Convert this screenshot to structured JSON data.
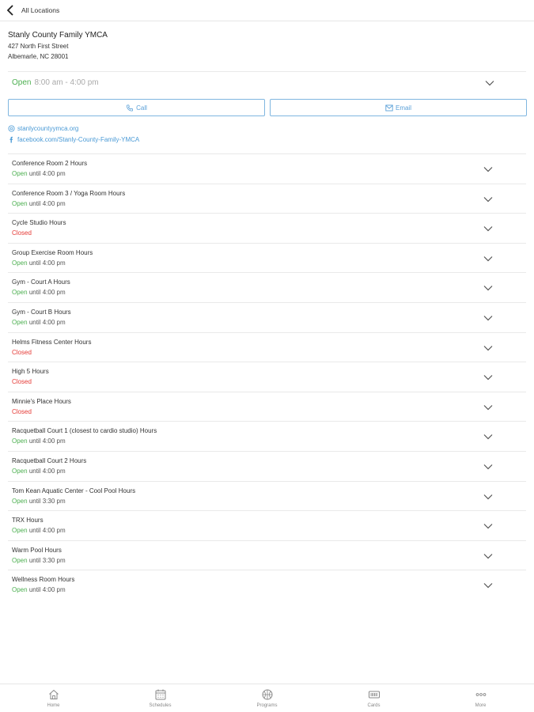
{
  "header": {
    "back_label": "All Locations"
  },
  "location": {
    "name": "Stanly County Family YMCA",
    "street": "427 North First Street",
    "city": "Albemarle, NC 28001"
  },
  "hours": {
    "status": "Open",
    "time": "8:00 am - 4:00 pm"
  },
  "actions": {
    "call_label": "Call",
    "email_label": "Email"
  },
  "links": {
    "website": "stanlycountyymca.org",
    "facebook": "facebook.com/Stanly-County-Family-YMCA"
  },
  "facilities": [
    {
      "title": "Conference Room 2 Hours",
      "status": "Open",
      "detail": "until 4:00 pm"
    },
    {
      "title": "Conference Room 3 / Yoga Room Hours",
      "status": "Open",
      "detail": "until 4:00 pm"
    },
    {
      "title": "Cycle Studio Hours",
      "status": "Closed",
      "detail": ""
    },
    {
      "title": "Group Exercise Room Hours",
      "status": "Open",
      "detail": "until 4:00 pm"
    },
    {
      "title": "Gym - Court A Hours",
      "status": "Open",
      "detail": "until 4:00 pm"
    },
    {
      "title": "Gym - Court B Hours",
      "status": "Open",
      "detail": "until 4:00 pm"
    },
    {
      "title": "Helms Fitness Center Hours",
      "status": "Closed",
      "detail": ""
    },
    {
      "title": "High 5 Hours",
      "status": "Closed",
      "detail": ""
    },
    {
      "title": "Minnie's Place Hours",
      "status": "Closed",
      "detail": ""
    },
    {
      "title": "Racquetball Court 1 (closest to cardio studio) Hours",
      "status": "Open",
      "detail": "until 4:00 pm"
    },
    {
      "title": "Racquetball Court 2 Hours",
      "status": "Open",
      "detail": "until 4:00 pm"
    },
    {
      "title": "Tom Kean Aquatic Center - Cool Pool Hours",
      "status": "Open",
      "detail": "until 3:30 pm"
    },
    {
      "title": "TRX Hours",
      "status": "Open",
      "detail": "until 4:00 pm"
    },
    {
      "title": "Warm Pool Hours",
      "status": "Open",
      "detail": "until 3:30 pm"
    },
    {
      "title": "Wellness Room Hours",
      "status": "Open",
      "detail": "until 4:00 pm"
    }
  ],
  "tabs": [
    {
      "label": "Home",
      "icon": "home-icon"
    },
    {
      "label": "Schedules",
      "icon": "calendar-icon"
    },
    {
      "label": "Programs",
      "icon": "basketball-icon"
    },
    {
      "label": "Cards",
      "icon": "barcode-icon"
    },
    {
      "label": "More",
      "icon": "more-icon"
    }
  ],
  "colors": {
    "open": "#4caf50",
    "closed": "#e53935",
    "link": "#4a9ad6",
    "button_border": "#7fb6e0"
  }
}
